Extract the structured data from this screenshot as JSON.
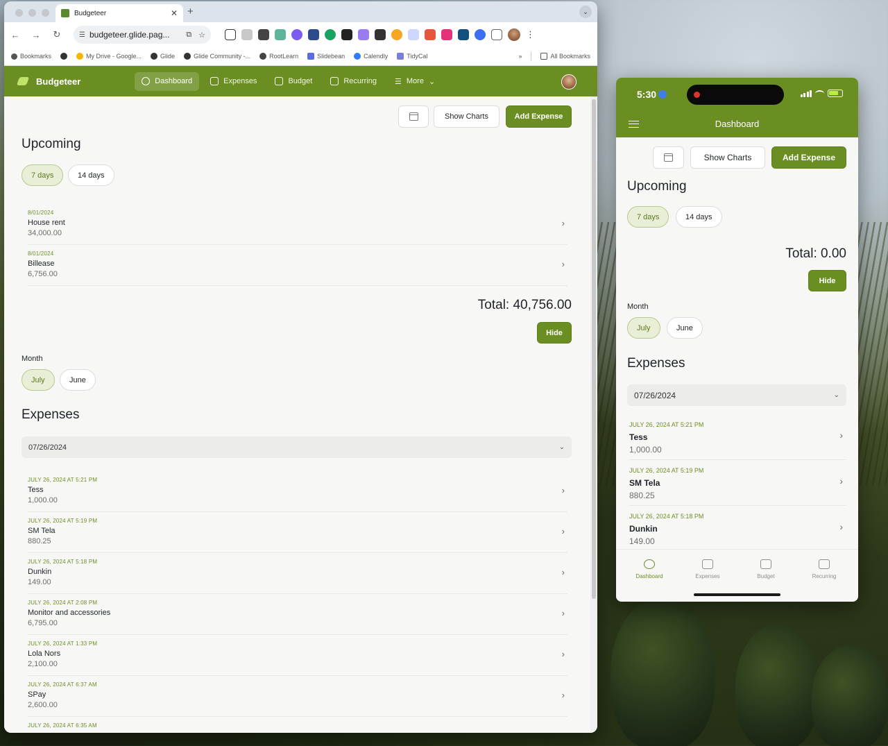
{
  "browser": {
    "tab_title": "Budgeteer",
    "url": "budgeteer.glide.pag...",
    "bookmarks": [
      "Bookmarks",
      "My Drive - Google...",
      "Glide",
      "Glide Community -...",
      "RootLearn",
      "Slidebean",
      "Calendly",
      "TidyCal"
    ],
    "bookmarks_more": "»",
    "all_bookmarks": "All Bookmarks"
  },
  "app": {
    "brand": "Budgeteer",
    "nav": [
      "Dashboard",
      "Expenses",
      "Budget",
      "Recurring",
      "More"
    ],
    "show_charts": "Show Charts",
    "add_expense": "Add Expense",
    "upcoming_title": "Upcoming",
    "range_options": [
      "7 days",
      "14 days"
    ],
    "upcoming": [
      {
        "date": "8/01/2024",
        "name": "House rent",
        "amount": "34,000.00"
      },
      {
        "date": "8/01/2024",
        "name": "Billease",
        "amount": "6,756.00"
      }
    ],
    "total": "Total: 40,756.00",
    "hide": "Hide",
    "month_label": "Month",
    "months": [
      "July",
      "June"
    ],
    "expenses_title": "Expenses",
    "date_select": "07/26/2024",
    "expenses": [
      {
        "date": "JULY 26, 2024 AT 5:21 PM",
        "name": "Tess",
        "amount": "1,000.00"
      },
      {
        "date": "JULY 26, 2024 AT 5:19 PM",
        "name": "SM Tela",
        "amount": "880.25"
      },
      {
        "date": "JULY 26, 2024 AT 5:18 PM",
        "name": "Dunkin",
        "amount": "149.00"
      },
      {
        "date": "JULY 26, 2024 AT 2:08 PM",
        "name": "Monitor and accessories",
        "amount": "6,795.00"
      },
      {
        "date": "JULY 26, 2024 AT 1:33 PM",
        "name": "Lola Nors",
        "amount": "2,100.00"
      },
      {
        "date": "JULY 26, 2024 AT 6:37 AM",
        "name": "SPay",
        "amount": "2,600.00"
      },
      {
        "date": "JULY 26, 2024 AT 6:35 AM",
        "name": "",
        "amount": ""
      }
    ]
  },
  "phone": {
    "time": "5:30",
    "title": "Dashboard",
    "show_charts": "Show Charts",
    "add_expense": "Add Expense",
    "upcoming_title": "Upcoming",
    "range_options": [
      "7 days",
      "14 days"
    ],
    "total": "Total: 0.00",
    "hide": "Hide",
    "month_label": "Month",
    "months": [
      "July",
      "June"
    ],
    "expenses_title": "Expenses",
    "date_select": "07/26/2024",
    "expenses": [
      {
        "date": "JULY 26, 2024 AT 5:21 PM",
        "name": "Tess",
        "amount": "1,000.00"
      },
      {
        "date": "JULY 26, 2024 AT 5:19 PM",
        "name": "SM Tela",
        "amount": "880.25"
      },
      {
        "date": "JULY 26, 2024 AT 5:18 PM",
        "name": "Dunkin",
        "amount": "149.00"
      }
    ],
    "tabs": [
      "Dashboard",
      "Expenses",
      "Budget",
      "Recurring"
    ]
  },
  "colors": {
    "brand": "#6b8e23",
    "pill_active_bg": "#e9efd6"
  }
}
